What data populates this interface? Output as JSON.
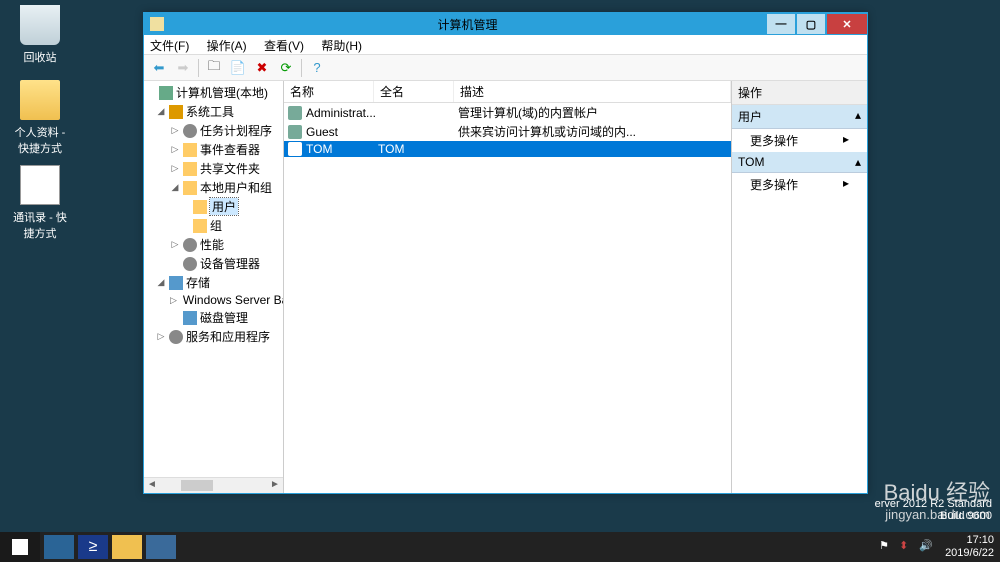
{
  "desktop": {
    "recycle": "回收站",
    "folder": "个人资料 - 快捷方式",
    "doc": "通讯录 - 快捷方式"
  },
  "window": {
    "title": "计算机管理",
    "menu": {
      "file": "文件(F)",
      "action": "操作(A)",
      "view": "查看(V)",
      "help": "帮助(H)"
    }
  },
  "tree": {
    "root": "计算机管理(本地)",
    "sysTools": "系统工具",
    "taskSched": "任务计划程序",
    "eventViewer": "事件查看器",
    "sharedFolders": "共享文件夹",
    "localUsers": "本地用户和组",
    "users": "用户",
    "groups": "组",
    "perf": "性能",
    "devmgr": "设备管理器",
    "storage": "存储",
    "wsb": "Windows Server Back",
    "diskmgmt": "磁盘管理",
    "svcapps": "服务和应用程序"
  },
  "list": {
    "colName": "名称",
    "colFullName": "全名",
    "colDesc": "描述",
    "rows": [
      {
        "name": "Administrat...",
        "full": "",
        "desc": "管理计算机(域)的内置帐户"
      },
      {
        "name": "Guest",
        "full": "",
        "desc": "供来宾访问计算机或访问域的内..."
      },
      {
        "name": "TOM",
        "full": "TOM",
        "desc": ""
      }
    ]
  },
  "actions": {
    "header": "操作",
    "sect1": "用户",
    "sect2": "TOM",
    "more": "更多操作"
  },
  "sysinfo": {
    "l1": "erver 2012 R2 Standard",
    "l2": "Build 9600"
  },
  "watermark": {
    "brand": "Baidu 经验",
    "url": "jingyan.baidu.com"
  },
  "tray": {
    "time": "17:10",
    "date": "2019/6/22"
  }
}
